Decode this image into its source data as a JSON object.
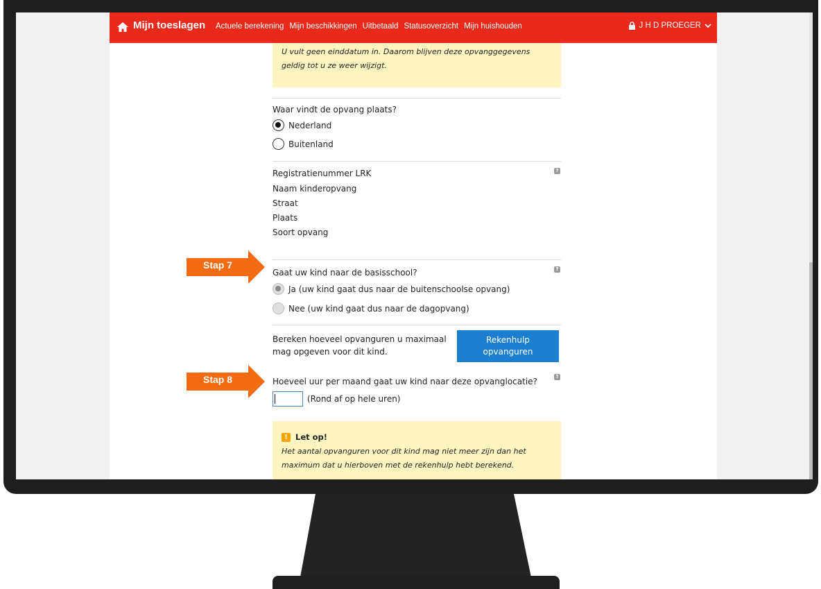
{
  "nav": {
    "brand": "Mijn toeslagen",
    "links": [
      "Actuele berekening",
      "Mijn beschikkingen",
      "Uitbetaald",
      "Statusoverzicht",
      "Mijn huishouden"
    ],
    "user": "J H D PROEGER"
  },
  "notice_top": "U vult geen einddatum in. Daarom blijven deze opvanggegevens geldig tot u ze weer wijzigt.",
  "location": {
    "question": "Waar vindt de opvang plaats?",
    "options": [
      {
        "label": "Nederland",
        "checked": true
      },
      {
        "label": "Buitenland",
        "checked": false
      }
    ]
  },
  "details": [
    "Registratienummer LRK",
    "Naam kinderopvang",
    "Straat",
    "Plaats",
    "Soort opvang"
  ],
  "school": {
    "question": "Gaat uw kind naar de basisschool?",
    "options": [
      {
        "label": "Ja (uw kind gaat dus naar de buitenschoolse opvang)",
        "checked": true
      },
      {
        "label": "Nee (uw kind gaat dus naar de dagopvang)",
        "checked": false
      }
    ]
  },
  "calc": {
    "text": "Bereken hoeveel opvanguren u maximaal mag opgeven voor dit kind.",
    "button": "Rekenhulp opvanguren"
  },
  "hours": {
    "question": "Hoeveel uur per maand gaat uw kind naar deze opvanglocatie?",
    "value": "",
    "hint": "(Rond af op hele uren)"
  },
  "warning": {
    "title": "Let op!",
    "text": "Het aantal opvanguren voor dit kind mag niet meer zijn dan het maximum dat u hierboven met de rekenhulp hebt berekend."
  },
  "steps": [
    "Stap 7",
    "Stap 8"
  ],
  "colors": {
    "nav": "#e8291c",
    "step": "#f26b12",
    "button": "#1a7fd1",
    "notice": "#fff5c0"
  }
}
